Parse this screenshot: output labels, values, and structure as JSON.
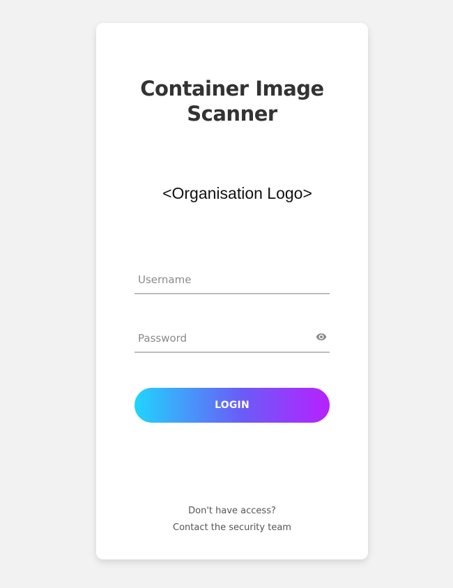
{
  "app": {
    "title": "Container Image Scanner",
    "logo_placeholder": "<Organisation Logo>"
  },
  "form": {
    "username": {
      "placeholder": "Username",
      "value": ""
    },
    "password": {
      "placeholder": "Password",
      "value": "",
      "toggle_icon": "eye-icon"
    },
    "login_label": "LOGIN"
  },
  "footer": {
    "question": "Don't have access?",
    "contact_link": "Contact the security team"
  },
  "colors": {
    "background": "#f2f2f2",
    "card": "#ffffff",
    "title": "#333333",
    "gradient_start": "#21d4fd",
    "gradient_end": "#b721ff",
    "input_border": "#bcbcbc"
  }
}
